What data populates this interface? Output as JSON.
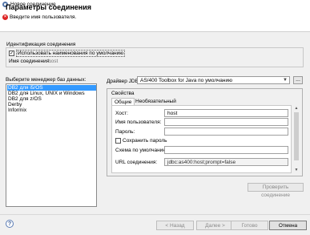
{
  "window": {
    "title": "Новое соединение"
  },
  "header": {
    "title": "Параметры соединения",
    "error_message": "Введите имя пользователя."
  },
  "identification": {
    "legend": "Идентификация соединения",
    "use_default_checkbox": {
      "label": "Использовать наименования по умолчанию",
      "checked": true,
      "mark": "✓"
    },
    "connection_name_label": "Имя соединения:",
    "connection_name_value": "host"
  },
  "db_manager": {
    "label": "Выберите менеджер баз данных:",
    "items": [
      {
        "label": "DB2 для i5/OS",
        "selected": true
      },
      {
        "label": "DB2 для Linux, UNIX и Windows",
        "selected": false
      },
      {
        "label": "DB2 для z/OS",
        "selected": false
      },
      {
        "label": "Derby",
        "selected": false
      },
      {
        "label": "Informix",
        "selected": false
      }
    ]
  },
  "jdbc": {
    "label": "Драйвер JDBC:",
    "selected": "AS/400 Toolbox for Java по умолчанию",
    "more_button": "..."
  },
  "properties": {
    "legend": "Свойства",
    "tabs": [
      {
        "label": "Общие",
        "active": true
      },
      {
        "label": "Необязательный",
        "active": false
      }
    ],
    "host_label": "Хост:",
    "host_value": "host",
    "user_label": "Имя пользователя:",
    "user_value": "",
    "password_label": "Пароль:",
    "password_value": "",
    "save_password_label": "Сохранить пароль",
    "schema_label": "Схема по умолчанию:",
    "schema_value": "",
    "url_label": "URL соединения:",
    "url_value": "jdbc:as400:host;prompt=false"
  },
  "test_button": "Проверить соединение",
  "footer": {
    "help": "?",
    "back": "< Назад",
    "next": "Далее >",
    "finish": "Готово",
    "cancel": "Отмена"
  }
}
